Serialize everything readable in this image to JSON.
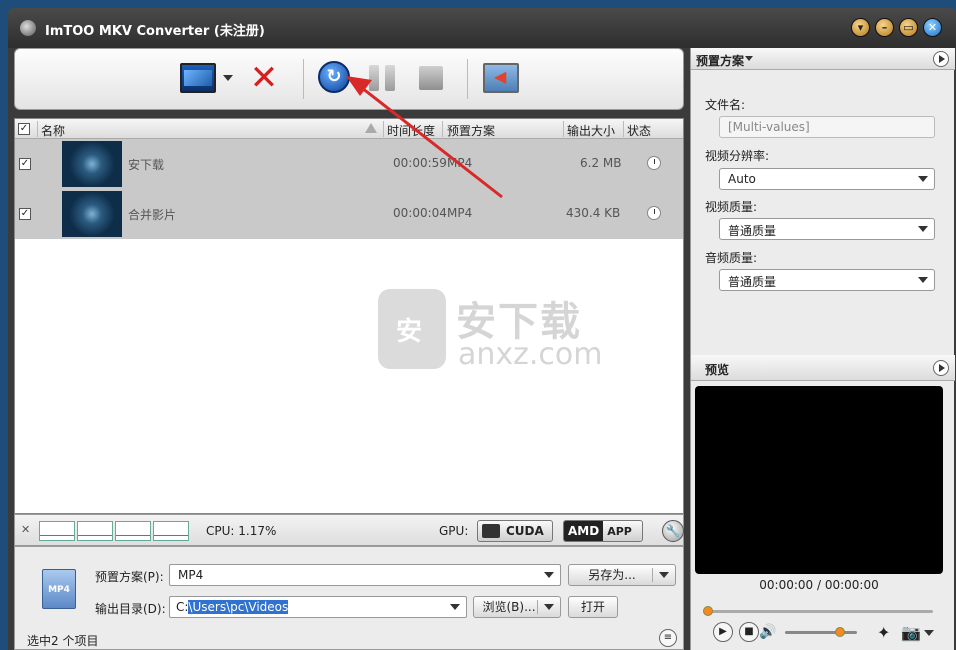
{
  "window": {
    "title": "ImTOO MKV Converter (未注册)"
  },
  "toolbar": {
    "convert_glyph": "↻",
    "remove_glyph": "✕"
  },
  "list": {
    "columns": {
      "name": "名称",
      "duration": "时间长度",
      "profile": "预置方案",
      "size": "输出大小",
      "status": "状态"
    },
    "rows": [
      {
        "checked": "✓",
        "name": "安下载",
        "duration": "00:00:59",
        "profile": "MP4",
        "size": "6.2 MB"
      },
      {
        "checked": "✓",
        "name": "合并影片",
        "duration": "00:00:04",
        "profile": "MP4",
        "size": "430.4 KB"
      }
    ],
    "header_check": "✓"
  },
  "watermark": {
    "line1": "安下载",
    "line2": "anxz.com"
  },
  "status": {
    "cpu": "CPU: 1.17%",
    "gpu_label": "GPU:",
    "cuda": "CUDA",
    "amd": "AMD",
    "app": "APP",
    "close_glyph": "✕"
  },
  "settings": {
    "profile_label": "预置方案(P):",
    "profile_value": "MP4",
    "save_as": "另存为...",
    "output_label": "输出目录(D):",
    "output_drive": "C:",
    "output_path": "\\Users\\pc\\Videos",
    "browse": "浏览(B)...",
    "open": "打开",
    "selection": "选中2 个项目",
    "mp4_badge": "MP4"
  },
  "right_panel": {
    "profile_title": "预置方案",
    "filename_label": "文件名:",
    "filename_value": "[Multi-values]",
    "resolution_label": "视频分辨率:",
    "resolution_value": "Auto",
    "video_quality_label": "视频质量:",
    "video_quality_value": "普通质量",
    "audio_quality_label": "音频质量:",
    "audio_quality_value": "普通质量",
    "preview_title": "预览",
    "time_readout": "00:00:00 / 00:00:00"
  },
  "colors": {
    "accent_orange": "#f58a1f",
    "annotation_red": "#d92828",
    "selection_blue": "#2f72d0"
  }
}
